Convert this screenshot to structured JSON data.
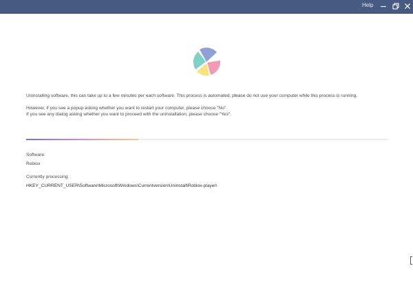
{
  "titlebar": {
    "help_label": "Help",
    "background_color": "#475a82",
    "buttons": [
      "minimize-icon",
      "restore-icon",
      "close-icon"
    ]
  },
  "logo": {
    "icon": "pie-logo-icon",
    "colors": [
      "#8fa0d4",
      "#f49ab8",
      "#fbe37c",
      "#7cd3c6"
    ]
  },
  "messages": {
    "line1": "Uninstalling software, this can take up to a few minutes per each software. This process is automated, please do not use your computer while this process is running.",
    "line2": "However, if you see a popup asking whether you want to restart your computer, please choose \"No\".",
    "line3": "If you see any dialog asking whether you want to proceed with the uninstallation, please choose \"Yes\"."
  },
  "progress": {
    "fraction": 0.31
  },
  "software": {
    "label": "Software:",
    "value": "Roblox"
  },
  "processing": {
    "label": "Currently processing:",
    "value": "HKEY_CURRENT_USER\\Software\\Microsoft\\Windows\\Currentversion\\Uninstall\\Roblox-player\\"
  }
}
